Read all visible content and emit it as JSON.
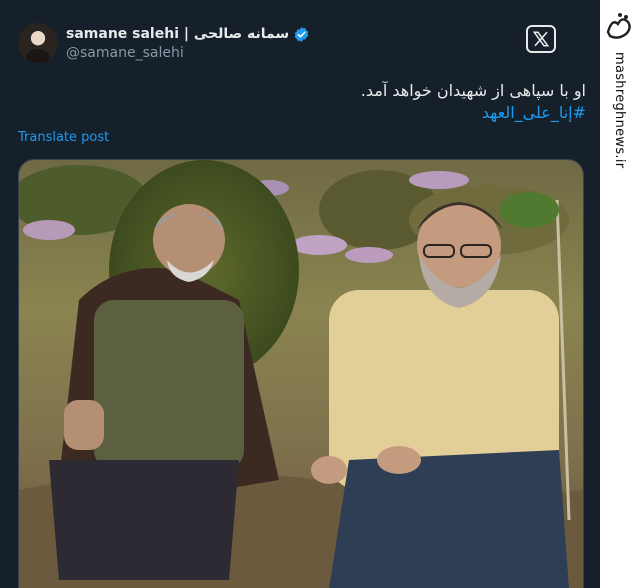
{
  "tweet": {
    "author": {
      "display_name": "samane salehi | سمانه صالحی",
      "handle": "@samane_salehi",
      "verified": true
    },
    "text_line1": "او با سپاهی از شهیدان خواهد آمد.",
    "hashtag": "#إنا_علی_العهد",
    "translate_label": "Translate post"
  },
  "watermark": {
    "site": "mashreghnews.ir",
    "brand_icon": "mashregh-logo-icon"
  },
  "colors": {
    "background": "#15202b",
    "text": "#e7e9ea",
    "muted": "#8b98a5",
    "link": "#1d9bf0",
    "verified": "#1d9bf0"
  }
}
